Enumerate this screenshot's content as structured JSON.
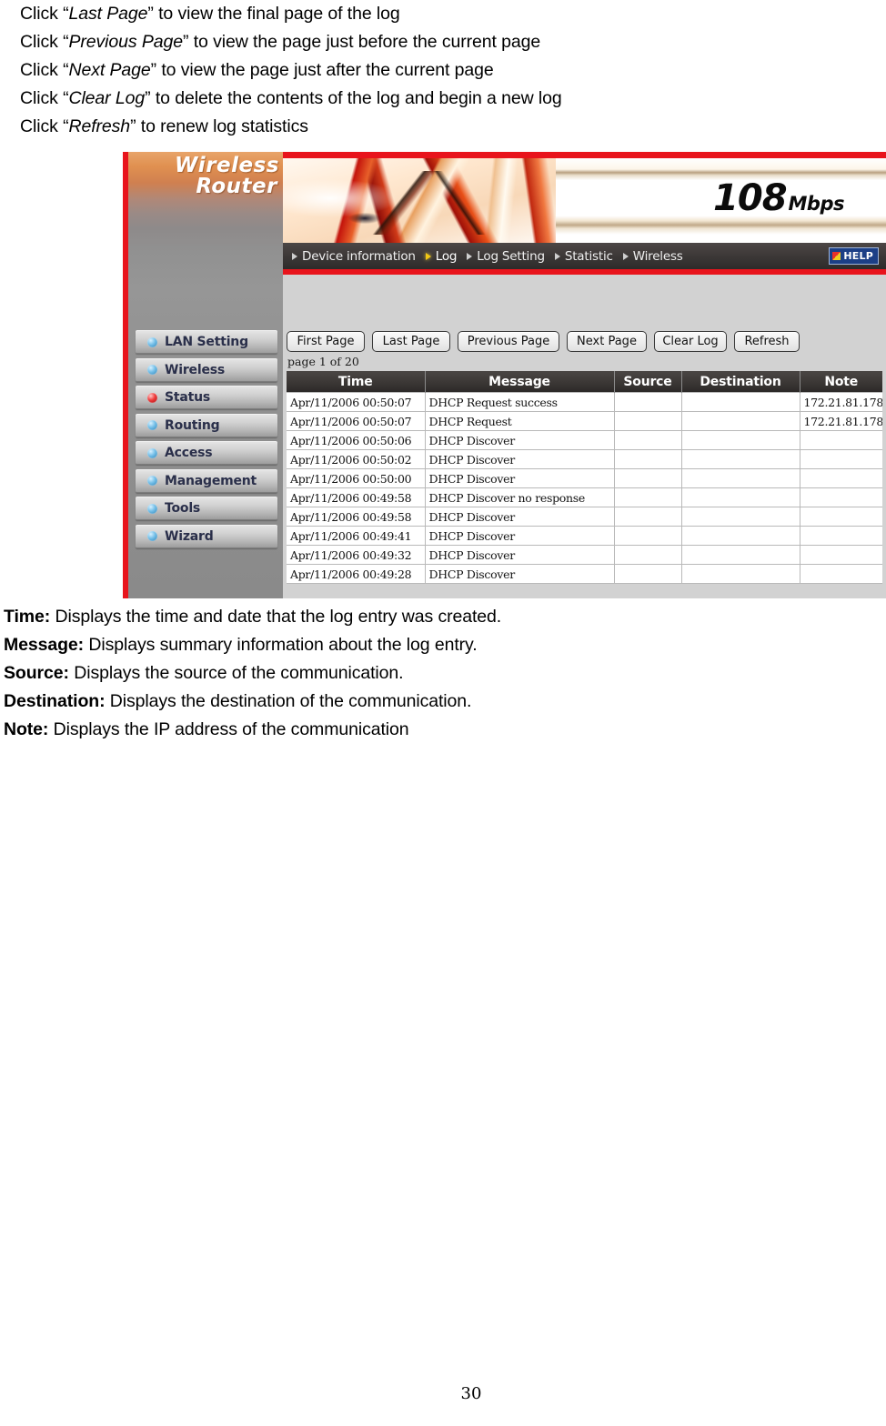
{
  "document": {
    "instructions": [
      {
        "prefix": "Click “",
        "emphasis": "Last Page",
        "suffix": "” to view the final page of the log"
      },
      {
        "prefix": "Click “",
        "emphasis": "Previous Page",
        "suffix": "” to view the page just before the current page"
      },
      {
        "prefix": "Click “",
        "emphasis": "Next Page",
        "suffix": "” to view the page just after the current page"
      },
      {
        "prefix": "Click “",
        "emphasis": "Clear Log",
        "suffix": "” to delete the contents of the log and begin a new log"
      },
      {
        "prefix": "Click “",
        "emphasis": "Refresh",
        "suffix": "” to renew log statistics"
      }
    ],
    "definitions": [
      {
        "term": "Time:",
        "text": " Displays the time and date that the log entry was created."
      },
      {
        "term": "Message:",
        "text": " Displays summary information about the log entry."
      },
      {
        "term": "Source:",
        "text": " Displays the source of the communication."
      },
      {
        "term": "Destination:",
        "text": " Displays the destination of the communication."
      },
      {
        "term": "Note:",
        "text": " Displays the IP address of the communication"
      }
    ],
    "page_number": "30"
  },
  "screenshot": {
    "brand": {
      "line1": "Wireless",
      "line2": "Router"
    },
    "banner": {
      "speed_value": "108",
      "speed_unit": "Mbps"
    },
    "sidebar": {
      "items": [
        {
          "label": "LAN Setting",
          "icon": "blue-bullet-icon",
          "active": false
        },
        {
          "label": "Wireless",
          "icon": "blue-bullet-icon",
          "active": false
        },
        {
          "label": "Status",
          "icon": "red-bullet-icon",
          "active": true
        },
        {
          "label": "Routing",
          "icon": "blue-bullet-icon",
          "active": false
        },
        {
          "label": "Access",
          "icon": "blue-bullet-icon",
          "active": false
        },
        {
          "label": "Management",
          "icon": "blue-bullet-icon",
          "active": false
        },
        {
          "label": "Tools",
          "icon": "blue-bullet-icon",
          "active": false
        },
        {
          "label": "Wizard",
          "icon": "blue-bullet-icon",
          "active": false
        }
      ]
    },
    "navbar": {
      "items": [
        {
          "label": "Device information",
          "selected": false
        },
        {
          "label": "Log",
          "selected": true
        },
        {
          "label": "Log Setting",
          "selected": false
        },
        {
          "label": "Statistic",
          "selected": false
        },
        {
          "label": "Wireless",
          "selected": false
        }
      ],
      "help_label": "HELP"
    },
    "toolbar": {
      "buttons": [
        {
          "label": "First Page"
        },
        {
          "label": "Last Page"
        },
        {
          "label": "Previous Page"
        },
        {
          "label": "Next Page"
        },
        {
          "label": "Clear Log"
        },
        {
          "label": "Refresh"
        }
      ]
    },
    "page_indicator": "page 1 of 20",
    "log_table": {
      "headers": [
        "Time",
        "Message",
        "Source",
        "Destination",
        "Note"
      ],
      "rows": [
        [
          "Apr/11/2006 00:50:07",
          "DHCP Request success",
          "",
          "",
          "172.21.81.178"
        ],
        [
          "Apr/11/2006 00:50:07",
          "DHCP Request",
          "",
          "",
          "172.21.81.178"
        ],
        [
          "Apr/11/2006 00:50:06",
          "DHCP Discover",
          "",
          "",
          ""
        ],
        [
          "Apr/11/2006 00:50:02",
          "DHCP Discover",
          "",
          "",
          ""
        ],
        [
          "Apr/11/2006 00:50:00",
          "DHCP Discover",
          "",
          "",
          ""
        ],
        [
          "Apr/11/2006 00:49:58",
          "DHCP Discover no response",
          "",
          "",
          ""
        ],
        [
          "Apr/11/2006 00:49:58",
          "DHCP Discover",
          "",
          "",
          ""
        ],
        [
          "Apr/11/2006 00:49:41",
          "DHCP Discover",
          "",
          "",
          ""
        ],
        [
          "Apr/11/2006 00:49:32",
          "DHCP Discover",
          "",
          "",
          ""
        ],
        [
          "Apr/11/2006 00:49:28",
          "DHCP Discover",
          "",
          "",
          ""
        ]
      ]
    },
    "colors": {
      "accent_red": "#e8141c",
      "navbar_dark": "#3b3736",
      "content_gray": "#d2d2d2",
      "active_bullet": "#ef3b3b",
      "bullet": "#74bfe8"
    }
  }
}
